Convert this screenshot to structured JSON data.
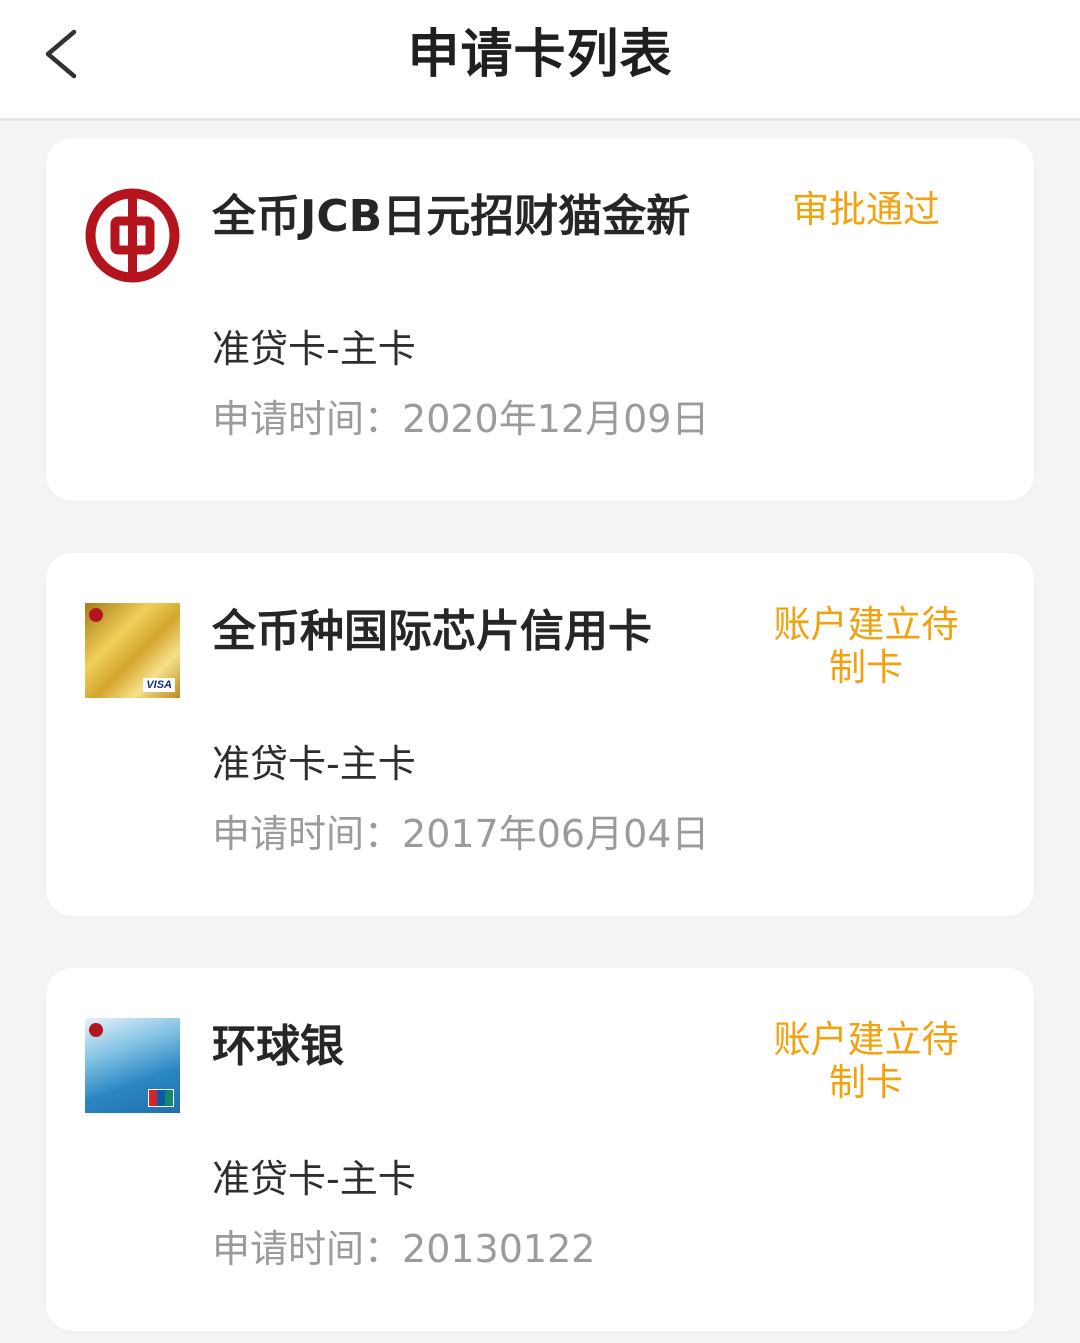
{
  "header": {
    "title": "申请卡列表",
    "back_icon": "chevron-left-icon"
  },
  "colors": {
    "status": "#f2a10f",
    "bank_red": "#b3141e"
  },
  "cards": [
    {
      "name": "全币JCB日元招财猫金新",
      "status": "审批通过",
      "type": "准贷卡-主卡",
      "date_label": "申请时间：",
      "date_value": "2020年12月09日",
      "thumb_icon": "bank-of-china-logo-icon"
    },
    {
      "name": "全币种国际芯片信用卡",
      "status": "账户建立待制卡",
      "type": "准贷卡-主卡",
      "date_label": "申请时间：",
      "date_value": "2017年06月04日",
      "thumb_icon": "gold-visa-card-icon"
    },
    {
      "name": "环球银",
      "status": "账户建立待制卡",
      "type": "准贷卡-主卡",
      "date_label": "申请时间：",
      "date_value": "20130122",
      "thumb_icon": "blue-unionpay-card-icon"
    }
  ]
}
